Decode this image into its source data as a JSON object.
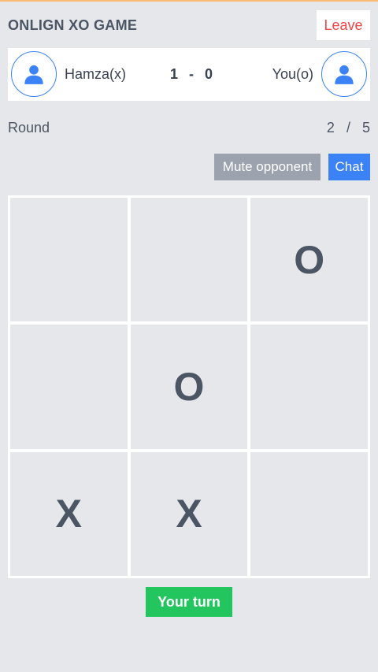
{
  "header": {
    "title": "ONLIGN XO GAME",
    "leave_label": "Leave"
  },
  "players": {
    "left": {
      "name": "Hamza(x)",
      "avatar_icon": "user-icon"
    },
    "right": {
      "name": "You(o)",
      "avatar_icon": "user-icon"
    },
    "score": {
      "left": "1",
      "separator": "-",
      "right": "0"
    }
  },
  "round": {
    "label": "Round",
    "current": "2",
    "separator": "/",
    "total": "5"
  },
  "actions": {
    "mute_label": "Mute opponent",
    "chat_label": "Chat"
  },
  "board": {
    "cells": [
      "",
      "",
      "O",
      "",
      "O",
      "",
      "X",
      "X",
      ""
    ]
  },
  "status": {
    "turn_label": "Your turn"
  },
  "colors": {
    "background": "#e5e7eb",
    "accent": "#3b82f6",
    "leave_text": "#ef4444",
    "turn_button": "#22c55e",
    "mute_button": "#9ca3af"
  }
}
